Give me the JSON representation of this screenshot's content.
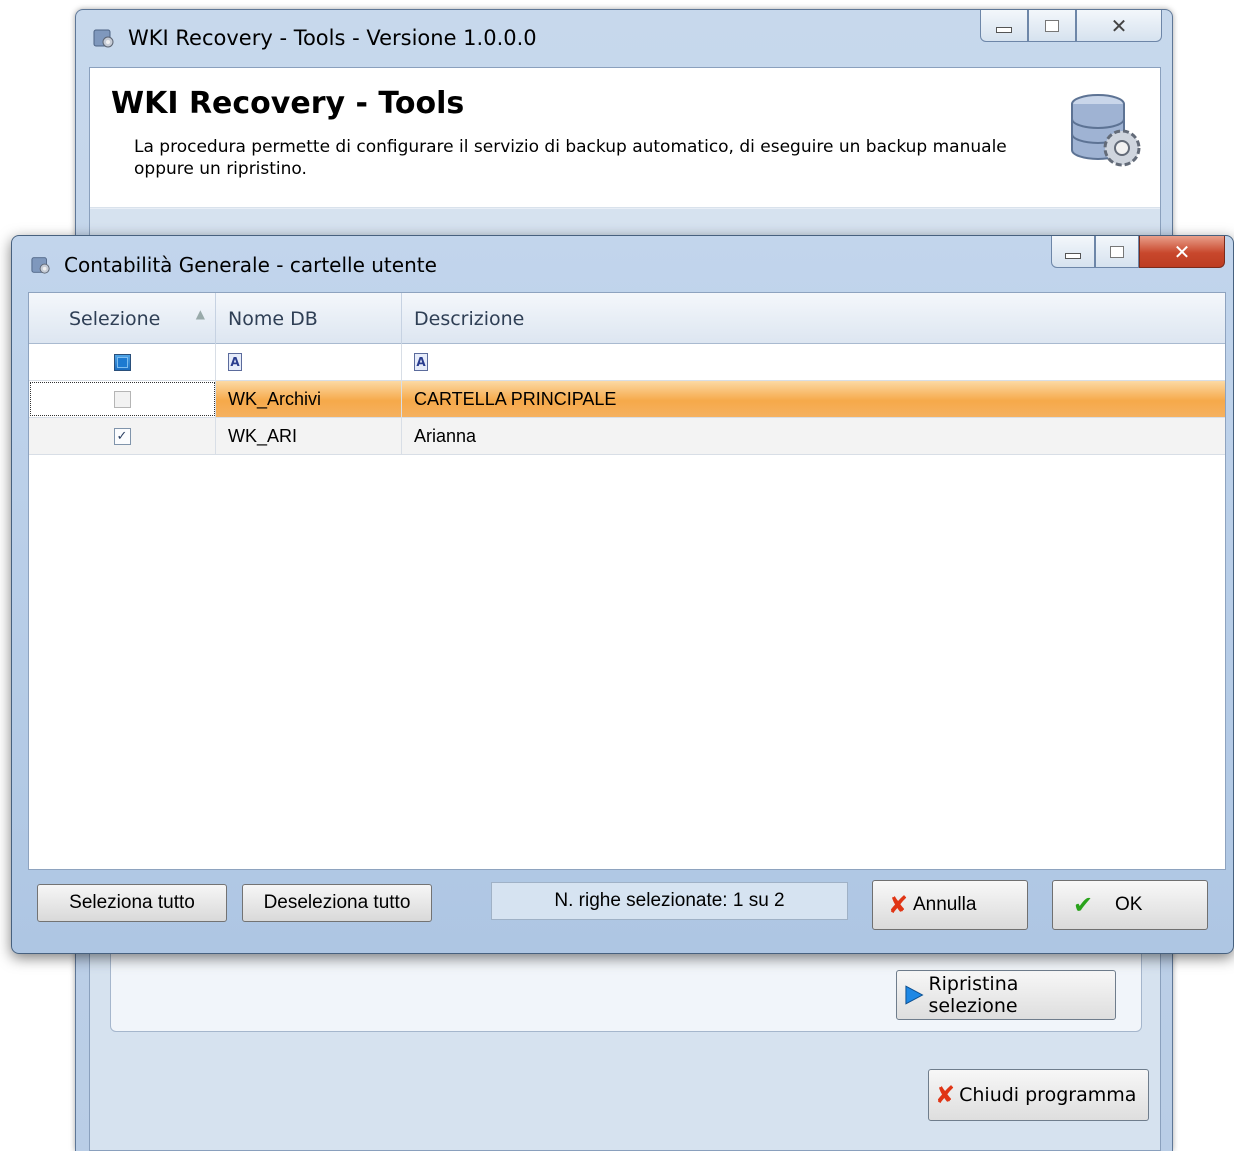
{
  "main_window": {
    "title": "WKI Recovery - Tools - Versione 1.0.0.0",
    "header_title": "WKI Recovery - Tools",
    "header_description": "La procedura permette di configurare il servizio di backup automatico, di eseguire un backup manuale oppure un ripristino.",
    "buttons": {
      "restore_selection": "Ripristina selezione",
      "close_program": "Chiudi programma"
    }
  },
  "dialog": {
    "title": "Contabilità Generale - cartelle utente",
    "columns": {
      "selection": "Selezione",
      "db_name": "Nome DB",
      "description": "Descrizione"
    },
    "rows": [
      {
        "selected": false,
        "db_name": "WK_Archivi",
        "description": "CARTELLA PRINCIPALE"
      },
      {
        "selected": true,
        "db_name": "WK_ARI",
        "description": "Arianna"
      }
    ],
    "buttons": {
      "select_all": "Seleziona tutto",
      "deselect_all": "Deseleziona tutto",
      "cancel": "Annulla",
      "ok": "OK"
    },
    "status": "N. righe selezionate: 1 su 2",
    "filter_glyph": "A"
  },
  "colors": {
    "selected_row": "#f6a94a",
    "window_frame": "#b9cde6",
    "close_button": "#c8472c"
  }
}
